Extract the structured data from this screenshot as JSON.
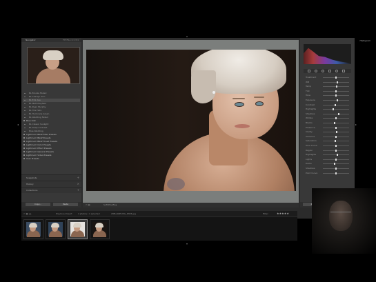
{
  "left_panel": {
    "title": "Navigator",
    "view_options": "FIT  FILL  1:1  3:1",
    "presets": [
      {
        "label": "BL Brooke Muted",
        "type": "item"
      },
      {
        "label": "BL Charlyn Arm",
        "type": "item"
      },
      {
        "label": "BL Erik Ave",
        "type": "item"
      },
      {
        "label": "BL Matt Mayfield",
        "type": "item"
      },
      {
        "label": "BL Ryan Murphy",
        "type": "item"
      },
      {
        "label": "BL The Hats",
        "type": "item"
      },
      {
        "label": "BL Hurricane Green",
        "type": "item"
      },
      {
        "label": "BL Wedding Faded",
        "type": "item"
      },
      {
        "label": "Blue Unit",
        "type": "folder"
      },
      {
        "label": "BL Classic Sunlight",
        "type": "item"
      },
      {
        "label": "BL Deep Contrast",
        "type": "item"
      },
      {
        "label": "Blue Wedding",
        "type": "item"
      },
      {
        "label": "Lightroom B&W Filter Presets",
        "type": "folder"
      },
      {
        "label": "Lightroom B&W Presets",
        "type": "folder"
      },
      {
        "label": "Lightroom B&W Toned Presets",
        "type": "folder"
      },
      {
        "label": "Lightroom Color Presets",
        "type": "folder"
      },
      {
        "label": "Lightroom Effect Presets",
        "type": "folder"
      },
      {
        "label": "Lightroom General Presets",
        "type": "folder"
      },
      {
        "label": "Lightroom Video Presets",
        "type": "folder"
      },
      {
        "label": "User Presets",
        "type": "folder"
      }
    ],
    "panels": [
      {
        "label": "Snapshots"
      },
      {
        "label": "History"
      },
      {
        "label": "Collections"
      }
    ],
    "copy_button": "Copy...",
    "paste_button": "Paste"
  },
  "toolbar": {
    "soft_proofing": "Soft Proofing"
  },
  "right_panel": {
    "title": "Histogram",
    "rows": [
      {
        "label": "Treatment",
        "pos": 0.5
      },
      {
        "label": "WB",
        "pos": 0.55
      },
      {
        "label": "Temp",
        "pos": 0.52
      },
      {
        "label": "Tint",
        "pos": 0.5
      },
      {
        "label": "Tone",
        "pos": 0.5
      },
      {
        "label": "Exposure",
        "pos": 0.55
      },
      {
        "label": "Contrast",
        "pos": 0.48
      },
      {
        "label": "Highlights",
        "pos": 0.4
      },
      {
        "label": "Shadows",
        "pos": 0.6
      },
      {
        "label": "Whites",
        "pos": 0.5
      },
      {
        "label": "Blacks",
        "pos": 0.45
      },
      {
        "label": "Presence",
        "pos": 0.5
      },
      {
        "label": "Clarity",
        "pos": 0.52
      },
      {
        "label": "Vibrance",
        "pos": 0.5
      },
      {
        "label": "Saturation",
        "pos": 0.47
      },
      {
        "label": "Tone Curve",
        "pos": 0.5
      },
      {
        "label": "Region",
        "pos": 0.5
      },
      {
        "label": "Highlights",
        "pos": 0.55
      },
      {
        "label": "Lights",
        "pos": 0.5
      },
      {
        "label": "Darks",
        "pos": 0.45
      },
      {
        "label": "Shadows",
        "pos": 0.5
      },
      {
        "label": "Point Curve",
        "pos": 0.5
      }
    ],
    "previous_button": "Previous",
    "reset_button": "Reset"
  },
  "filmstrip": {
    "label": "Previous Import",
    "count": "4 photos / 1 selected",
    "filename": "/MELANIE-IMG_6383.jpg",
    "filter_label": "Filter:",
    "stars": "★★★★★"
  }
}
